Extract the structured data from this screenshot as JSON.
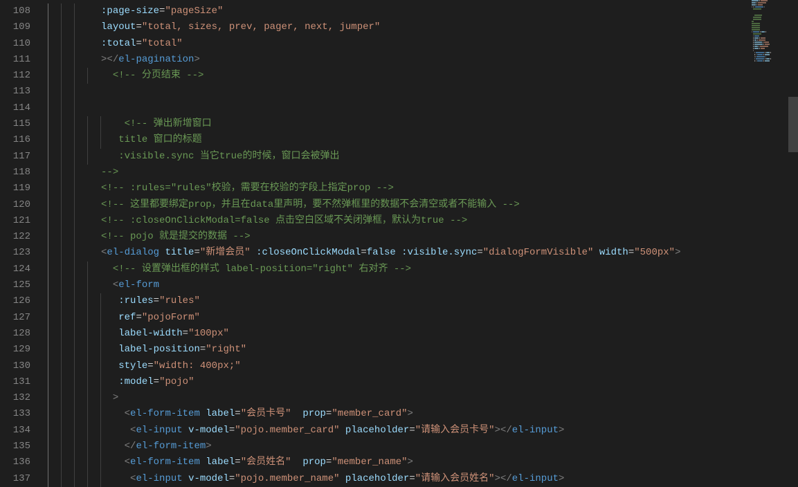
{
  "startLine": 108,
  "lines": [
    {
      "indent": 3,
      "tokens": [
        [
          "attr",
          ":page-size"
        ],
        [
          "eq",
          "="
        ],
        [
          "str",
          "\"pageSize\""
        ]
      ]
    },
    {
      "indent": 3,
      "tokens": [
        [
          "attr",
          "layout"
        ],
        [
          "eq",
          "="
        ],
        [
          "str",
          "\"total, sizes, prev, pager, next, jumper\""
        ]
      ]
    },
    {
      "indent": 3,
      "tokens": [
        [
          "attr",
          ":total"
        ],
        [
          "eq",
          "="
        ],
        [
          "str",
          "\"total\""
        ]
      ]
    },
    {
      "indent": 3,
      "tokens": [
        [
          "punct",
          ">"
        ],
        [
          "punct",
          "</"
        ],
        [
          "tag",
          "el-pagination"
        ],
        [
          "punct",
          ">"
        ]
      ]
    },
    {
      "indent": 4,
      "tokens": [
        [
          "comment",
          "<!-- 分页结束 -->"
        ]
      ]
    },
    {
      "indent": 0,
      "tokens": []
    },
    {
      "indent": 0,
      "tokens": []
    },
    {
      "indent": 5,
      "tokens": [
        [
          "comment",
          "<!-- 弹出新增窗口"
        ]
      ]
    },
    {
      "indent": 4,
      "tokens": [
        [
          "comment",
          " title 窗口的标题"
        ]
      ]
    },
    {
      "indent": 4,
      "tokens": [
        [
          "comment",
          " :visible.sync 当它true的时候，窗口会被弹出"
        ]
      ]
    },
    {
      "indent": 3,
      "tokens": [
        [
          "comment",
          "-->"
        ]
      ]
    },
    {
      "indent": 3,
      "tokens": [
        [
          "comment",
          "<!-- :rules=\"rules\"校验，需要在校验的字段上指定prop -->"
        ]
      ]
    },
    {
      "indent": 3,
      "tokens": [
        [
          "comment",
          "<!-- 这里都要绑定prop，并且在data里声明，要不然弹框里的数据不会清空或者不能输入 -->"
        ]
      ]
    },
    {
      "indent": 3,
      "tokens": [
        [
          "comment",
          "<!-- :closeOnClickModal=false 点击空白区域不关闭弹框，默认为true -->"
        ]
      ]
    },
    {
      "indent": 3,
      "tokens": [
        [
          "comment",
          "<!-- pojo 就是提交的数据 -->"
        ]
      ]
    },
    {
      "indent": 3,
      "tokens": [
        [
          "punct",
          "<"
        ],
        [
          "tag",
          "el-dialog"
        ],
        [
          "eq",
          " "
        ],
        [
          "attr",
          "title"
        ],
        [
          "eq",
          "="
        ],
        [
          "str",
          "\"新增会员\""
        ],
        [
          "eq",
          " "
        ],
        [
          "attr",
          ":closeOnClickModal"
        ],
        [
          "eq",
          "="
        ],
        [
          "attr",
          "false"
        ],
        [
          "eq",
          " "
        ],
        [
          "attr",
          ":visible.sync"
        ],
        [
          "eq",
          "="
        ],
        [
          "str",
          "\"dialogFormVisible\""
        ],
        [
          "eq",
          " "
        ],
        [
          "attr",
          "width"
        ],
        [
          "eq",
          "="
        ],
        [
          "str",
          "\"500px\""
        ],
        [
          "punct",
          ">"
        ]
      ]
    },
    {
      "indent": 4,
      "tokens": [
        [
          "comment",
          "<!-- 设置弹出框的样式 label-position=\"right\" 右对齐 -->"
        ]
      ]
    },
    {
      "indent": 4,
      "tokens": [
        [
          "punct",
          "<"
        ],
        [
          "tag",
          "el-form"
        ]
      ]
    },
    {
      "indent": 4,
      "tokens": [
        [
          "eq",
          " "
        ],
        [
          "attr",
          ":rules"
        ],
        [
          "eq",
          "="
        ],
        [
          "str",
          "\"rules\""
        ]
      ]
    },
    {
      "indent": 4,
      "tokens": [
        [
          "eq",
          " "
        ],
        [
          "attr",
          "ref"
        ],
        [
          "eq",
          "="
        ],
        [
          "str",
          "\"pojoForm\""
        ]
      ]
    },
    {
      "indent": 4,
      "tokens": [
        [
          "eq",
          " "
        ],
        [
          "attr",
          "label-width"
        ],
        [
          "eq",
          "="
        ],
        [
          "str",
          "\"100px\""
        ]
      ]
    },
    {
      "indent": 4,
      "tokens": [
        [
          "eq",
          " "
        ],
        [
          "attr",
          "label-position"
        ],
        [
          "eq",
          "="
        ],
        [
          "str",
          "\"right\""
        ]
      ]
    },
    {
      "indent": 4,
      "tokens": [
        [
          "eq",
          " "
        ],
        [
          "attr",
          "style"
        ],
        [
          "eq",
          "="
        ],
        [
          "str",
          "\"width: 400px;\""
        ]
      ]
    },
    {
      "indent": 4,
      "tokens": [
        [
          "eq",
          " "
        ],
        [
          "attr",
          ":model"
        ],
        [
          "eq",
          "="
        ],
        [
          "str",
          "\"pojo\""
        ]
      ]
    },
    {
      "indent": 4,
      "tokens": [
        [
          "punct",
          ">"
        ]
      ]
    },
    {
      "indent": 5,
      "tokens": [
        [
          "punct",
          "<"
        ],
        [
          "tag",
          "el-form-item"
        ],
        [
          "eq",
          " "
        ],
        [
          "attr",
          "label"
        ],
        [
          "eq",
          "="
        ],
        [
          "str",
          "\"会员卡号\""
        ],
        [
          "eq",
          "  "
        ],
        [
          "attr",
          "prop"
        ],
        [
          "eq",
          "="
        ],
        [
          "str",
          "\"member_card\""
        ],
        [
          "punct",
          ">"
        ]
      ]
    },
    {
      "indent": 5,
      "tokens": [
        [
          "eq",
          " "
        ],
        [
          "punct",
          "<"
        ],
        [
          "tag",
          "el-input"
        ],
        [
          "eq",
          " "
        ],
        [
          "attr",
          "v-model"
        ],
        [
          "eq",
          "="
        ],
        [
          "str",
          "\"pojo.member_card\""
        ],
        [
          "eq",
          " "
        ],
        [
          "attr",
          "placeholder"
        ],
        [
          "eq",
          "="
        ],
        [
          "str",
          "\"请输入会员卡号\""
        ],
        [
          "punct",
          ">"
        ],
        [
          "punct",
          "</"
        ],
        [
          "tag",
          "el-input"
        ],
        [
          "punct",
          ">"
        ]
      ]
    },
    {
      "indent": 5,
      "tokens": [
        [
          "punct",
          "</"
        ],
        [
          "tag",
          "el-form-item"
        ],
        [
          "punct",
          ">"
        ]
      ]
    },
    {
      "indent": 5,
      "tokens": [
        [
          "punct",
          "<"
        ],
        [
          "tag",
          "el-form-item"
        ],
        [
          "eq",
          " "
        ],
        [
          "attr",
          "label"
        ],
        [
          "eq",
          "="
        ],
        [
          "str",
          "\"会员姓名\""
        ],
        [
          "eq",
          "  "
        ],
        [
          "attr",
          "prop"
        ],
        [
          "eq",
          "="
        ],
        [
          "str",
          "\"member_name\""
        ],
        [
          "punct",
          ">"
        ]
      ]
    },
    {
      "indent": 5,
      "tokens": [
        [
          "eq",
          " "
        ],
        [
          "punct",
          "<"
        ],
        [
          "tag",
          "el-input"
        ],
        [
          "eq",
          " "
        ],
        [
          "attr",
          "v-model"
        ],
        [
          "eq",
          "="
        ],
        [
          "str",
          "\"pojo.member_name\""
        ],
        [
          "eq",
          " "
        ],
        [
          "attr",
          "placeholder"
        ],
        [
          "eq",
          "="
        ],
        [
          "str",
          "\"请输入会员姓名\""
        ],
        [
          "punct",
          ">"
        ],
        [
          "punct",
          "</"
        ],
        [
          "tag",
          "el-input"
        ],
        [
          "punct",
          ">"
        ]
      ]
    }
  ],
  "guides": [
    {
      "col": 0,
      "from": 0,
      "to": 30,
      "active": true
    },
    {
      "col": 1,
      "from": 0,
      "to": 30,
      "active": false
    },
    {
      "col": 2,
      "from": 0,
      "to": 30,
      "active": false
    },
    {
      "col": 3,
      "from": 4,
      "to": 5,
      "active": false
    },
    {
      "col": 3,
      "from": 7,
      "to": 10,
      "active": false
    },
    {
      "col": 4,
      "from": 7,
      "to": 9,
      "active": false
    },
    {
      "col": 3,
      "from": 16,
      "to": 30,
      "active": false
    },
    {
      "col": 4,
      "from": 18,
      "to": 30,
      "active": false
    }
  ]
}
